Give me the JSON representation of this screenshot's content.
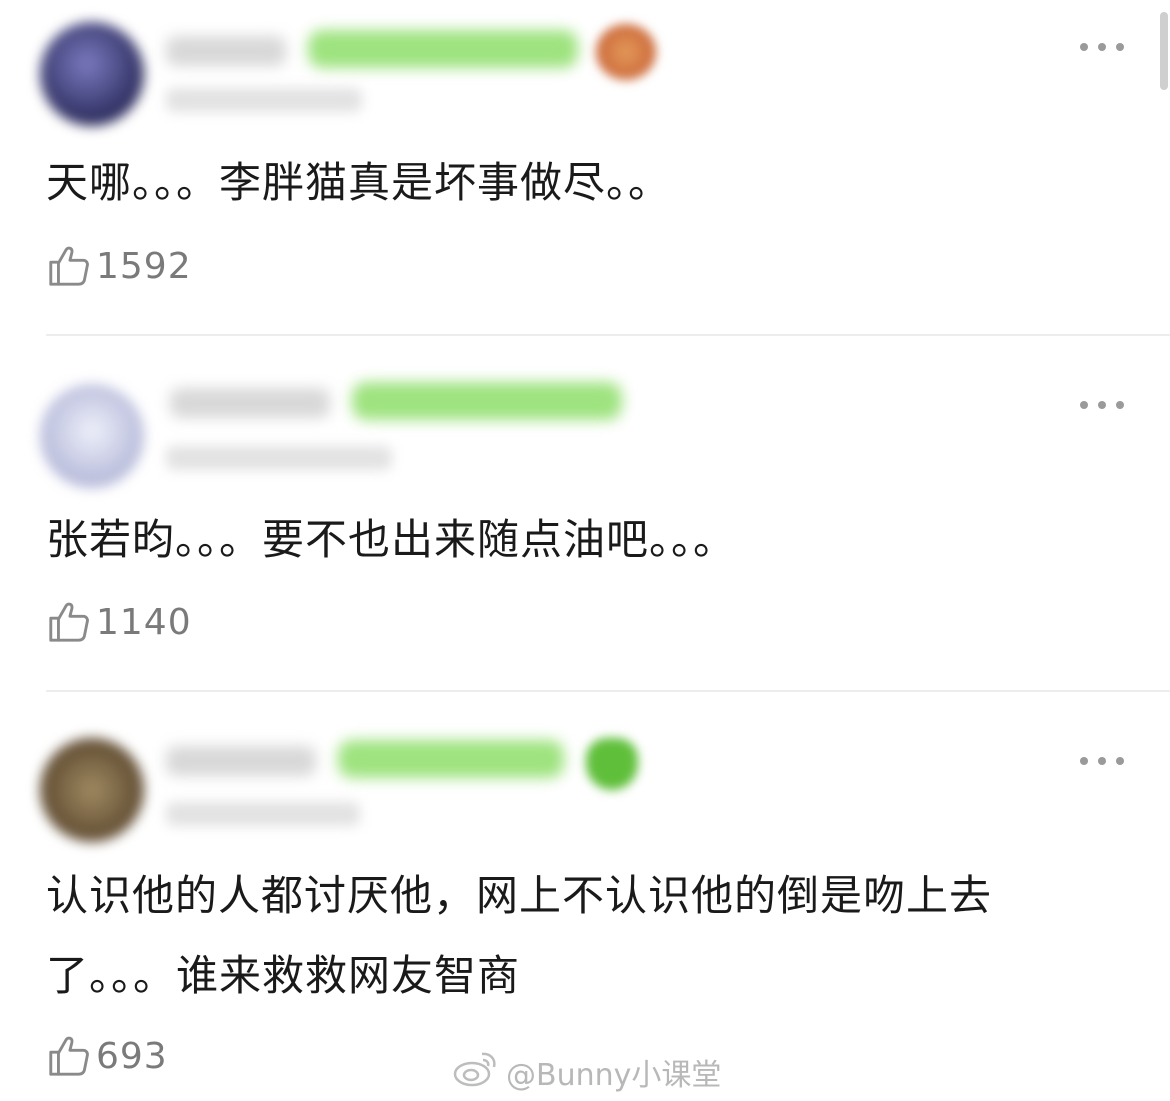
{
  "comments": [
    {
      "text": "天哪。。。李胖猫真是坏事做尽。。",
      "likes": "1592",
      "avatar_color": "#4a4a8a"
    },
    {
      "text": "张若昀。。。要不也出来随点油吧。。。",
      "likes": "1140",
      "avatar_color": "#c9cce4"
    },
    {
      "text": "认识他的人都讨厌他，网上不认识他的倒是吻上去了。。。谁来救救网友智商",
      "likes": "693",
      "avatar_color": "#8a7350"
    }
  ],
  "icons": {
    "like": "thumbs-up-icon",
    "more": "more-dots-icon",
    "watermark": "weibo-logo-icon"
  },
  "watermark": {
    "text": "@Bunny小课堂"
  },
  "colors": {
    "badge_green": "#9ee37f",
    "text": "#1a1a1a",
    "muted": "#7a7a7a",
    "divider": "#ededed"
  }
}
